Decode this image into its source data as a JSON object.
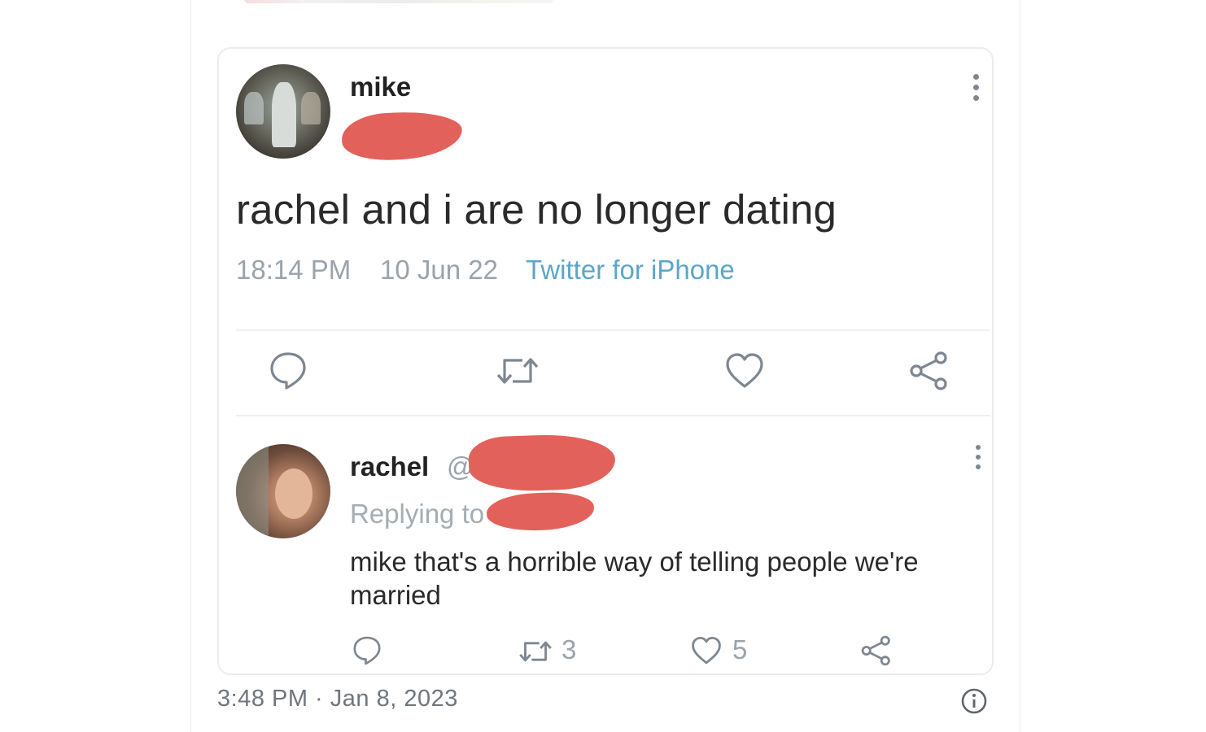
{
  "original_tweet": {
    "author": "mike",
    "text": "rachel and i are no longer dating",
    "time": "18:14 PM",
    "date": "10 Jun 22",
    "source": "Twitter for iPhone"
  },
  "reply": {
    "author": "rachel",
    "handle_prefix": "@",
    "replying_prefix": "Replying to",
    "text": "mike that's a horrible way of telling people we're married",
    "retweet_count": "3",
    "like_count": "5"
  },
  "post_footer": {
    "timestamp": "3:48 PM · Jan 8, 2023"
  },
  "icons": {
    "reply": "reply-bubble-icon",
    "retweet": "retweet-icon",
    "like": "heart-icon",
    "share": "share-icon",
    "more": "more-vertical-icon",
    "info": "info-icon"
  },
  "colors": {
    "redaction": "#e2625b",
    "source_link": "#5ba6c8",
    "muted_text": "#9aa3ab",
    "icon_stroke": "#7e8790"
  }
}
